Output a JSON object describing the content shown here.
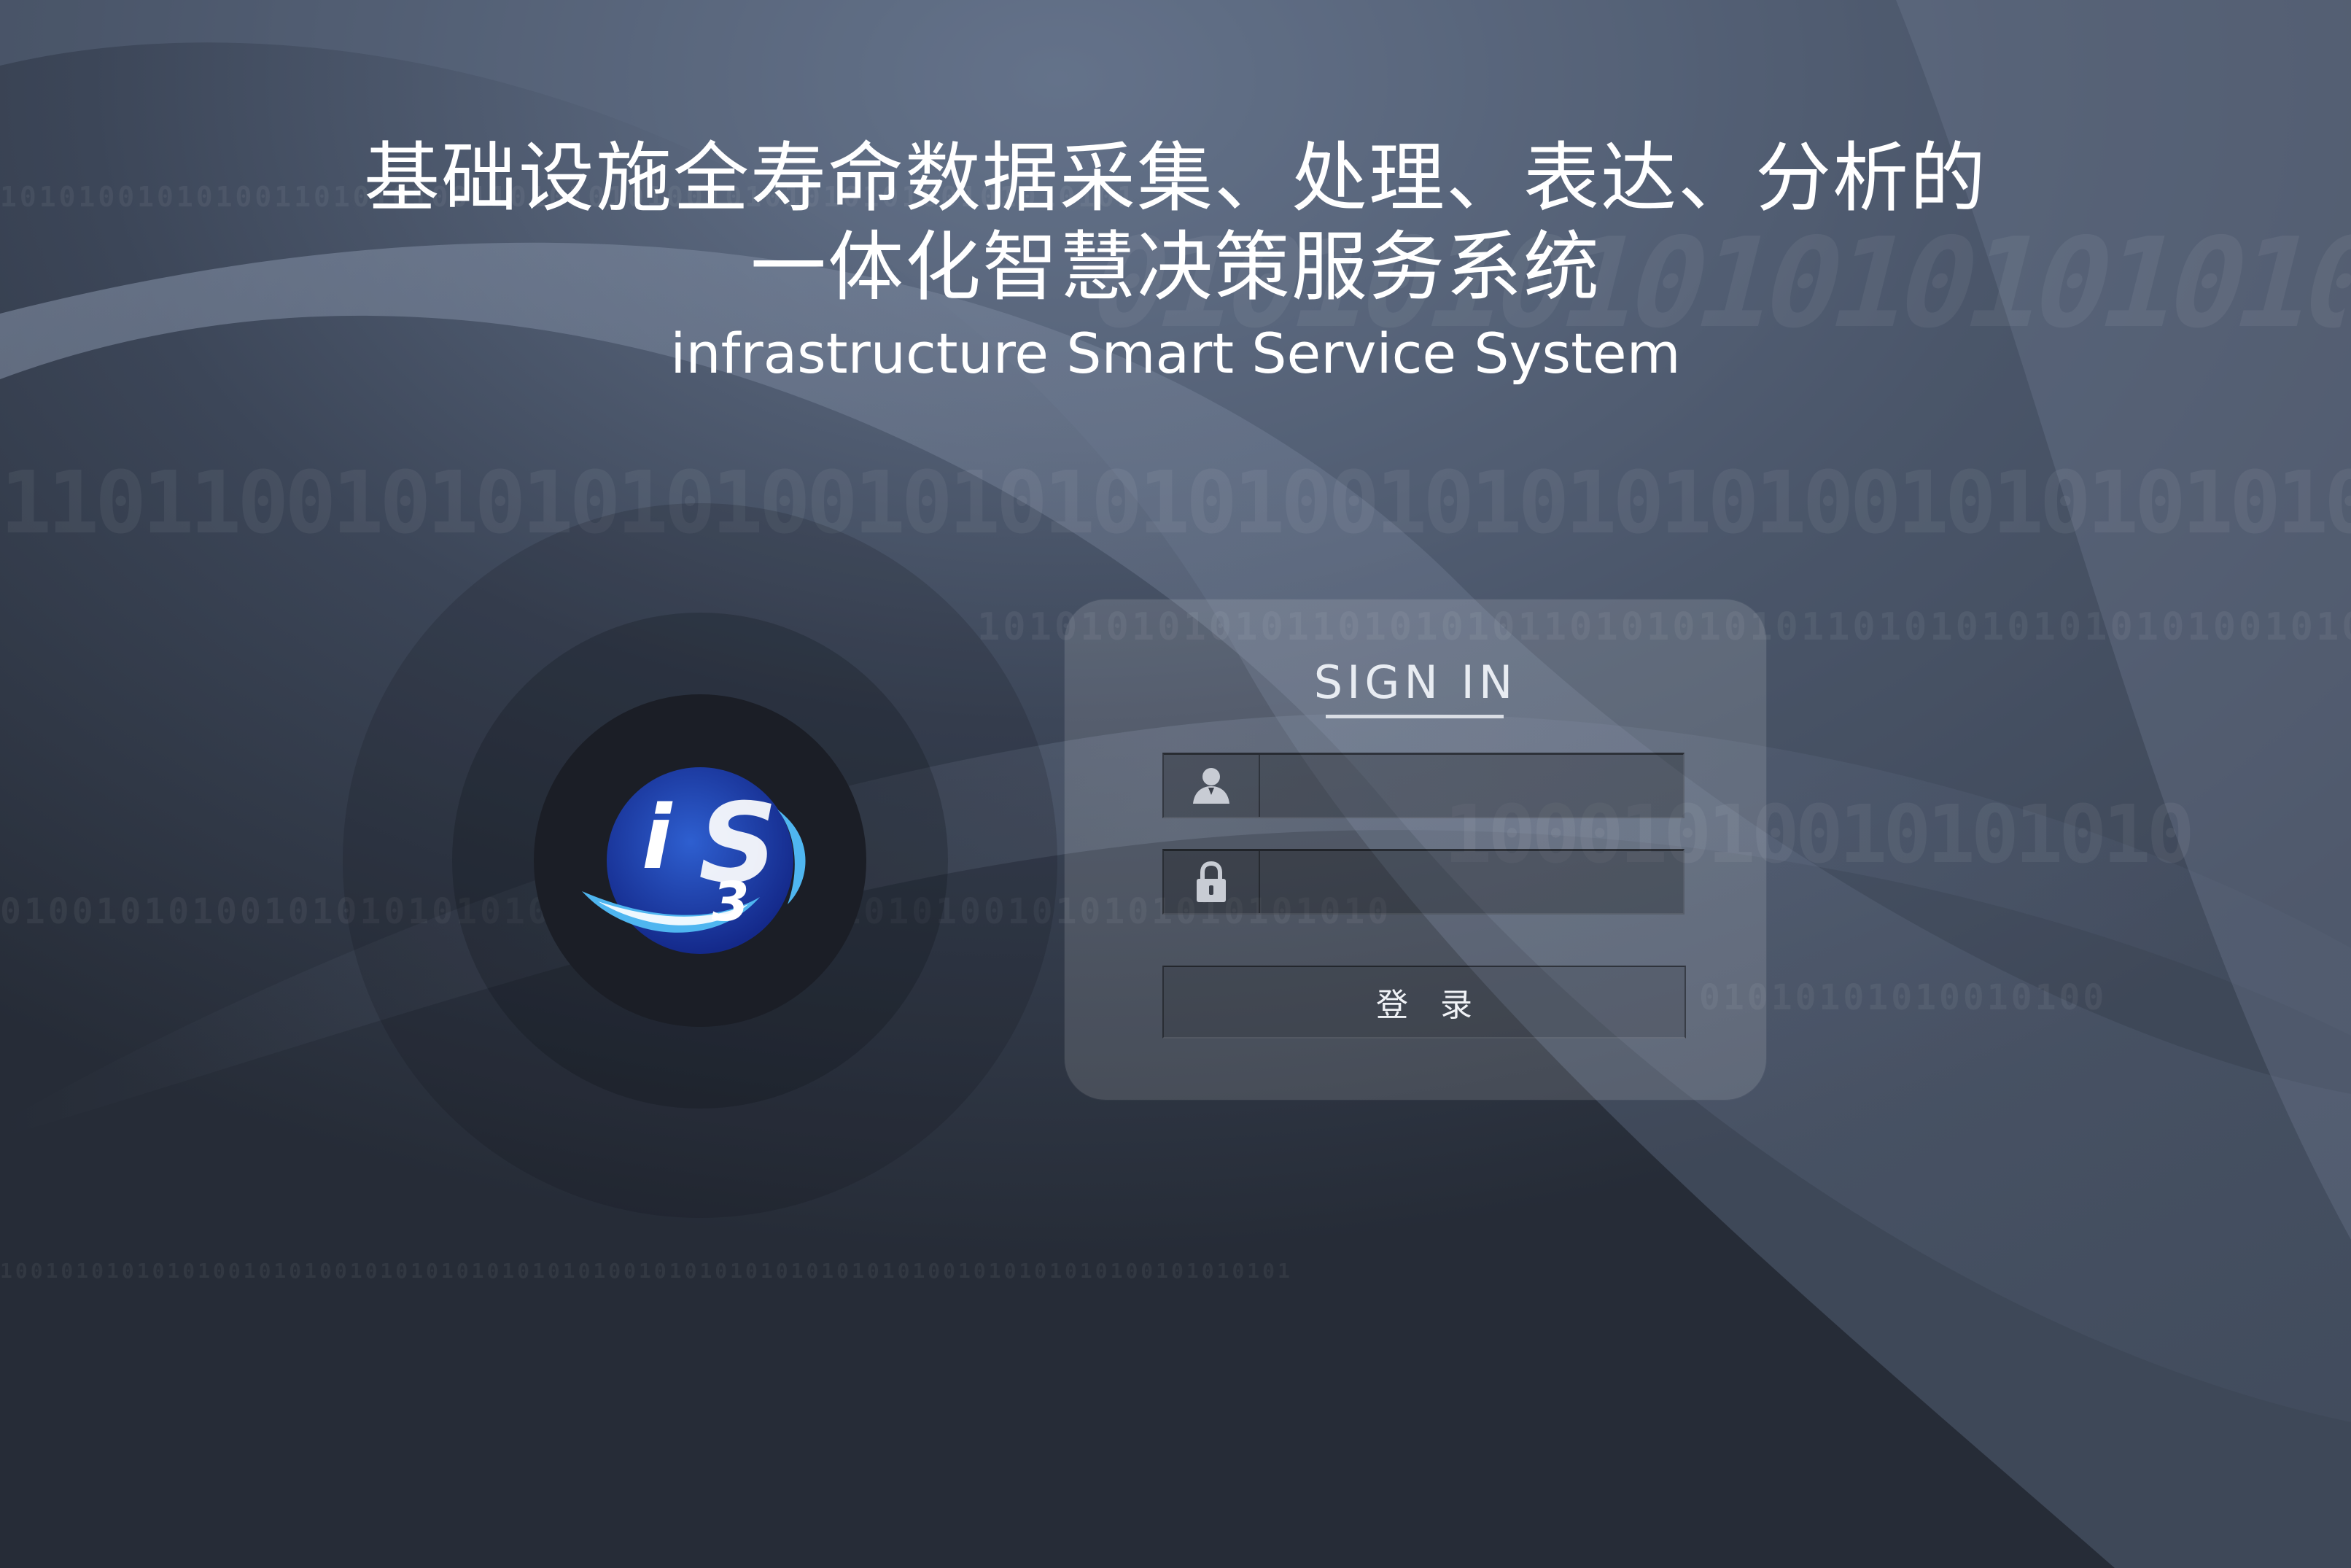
{
  "header": {
    "title_line1": "基础设施全寿命数据采集、处理、表达、分析的",
    "title_line2": "一体化智慧决策服务系统",
    "subtitle": "infrastructure Smart Service System"
  },
  "background": {
    "binary_rows": [
      "1010100101010011010101001101010101001010101010100101010101",
      "01010101010101010101",
      "1101100101010101001010101010010101010100101010101010",
      "1010101010101101010101101010101011010101010101010010101",
      "10001010010101010",
      "0100101010010101010101001010101001010101001010101010101010",
      "01010101010010100",
      "1001010101010100101010010101010101010101001010101010101010101001010101010100101010101"
    ]
  },
  "logo": {
    "letter_i": "i",
    "letter_s": "S",
    "digit_3": "3"
  },
  "login": {
    "title": "SIGN IN",
    "username_icon": "user-icon",
    "password_icon": "lock-icon",
    "username_value": "",
    "password_value": "",
    "submit_label": "登录"
  },
  "colors": {
    "background": "#2b313d",
    "panel": "rgba(255,255,255,0.13)",
    "logo_blue": "#1c3fae",
    "logo_cyan": "#4fb6f0"
  }
}
